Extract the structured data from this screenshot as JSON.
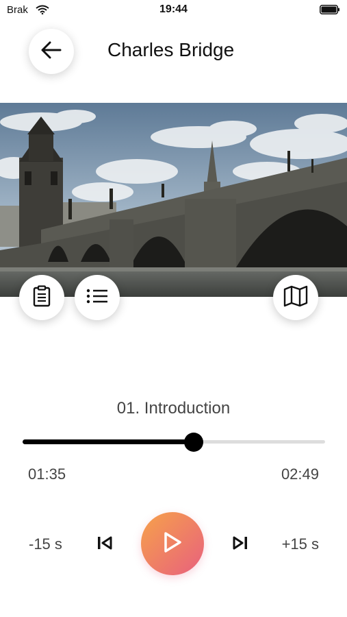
{
  "status_bar": {
    "carrier": "Brak",
    "time": "19:44"
  },
  "header": {
    "title": "Charles Bridge",
    "back_icon": "arrow-left-icon"
  },
  "hero": {
    "subject": "Charles Bridge photo"
  },
  "actions": {
    "notes_icon": "clipboard-icon",
    "list_icon": "list-icon",
    "map_icon": "map-icon"
  },
  "player": {
    "track_title": "01. Introduction",
    "progress_fraction": 0.565,
    "current_time": "01:35",
    "total_time": "02:49",
    "skip_back_label": "-15 s",
    "skip_forward_label": "+15 s",
    "play_colors": [
      "#f6a24a",
      "#e8607e"
    ]
  }
}
